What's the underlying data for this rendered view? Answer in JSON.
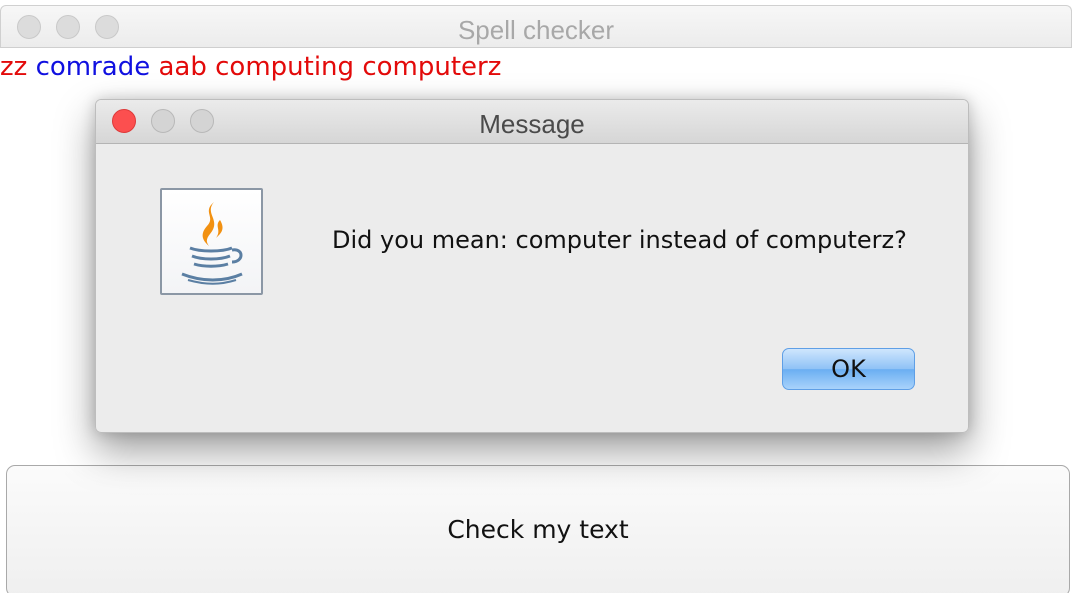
{
  "window": {
    "title": "Spell checker"
  },
  "text_words": [
    {
      "text": "zz",
      "color": "#e30a0a"
    },
    {
      "text": "comrade",
      "color": "#1010e0"
    },
    {
      "text": "aab",
      "color": "#e30a0a"
    },
    {
      "text": "computing",
      "color": "#e30a0a"
    },
    {
      "text": "computerz",
      "color": "#e30a0a"
    }
  ],
  "dialog": {
    "title": "Message",
    "icon": "java-coffee-cup-icon",
    "message": "Did you mean: computer instead of computerz?",
    "ok_label": "OK"
  },
  "check_button": {
    "label": "Check my text"
  }
}
